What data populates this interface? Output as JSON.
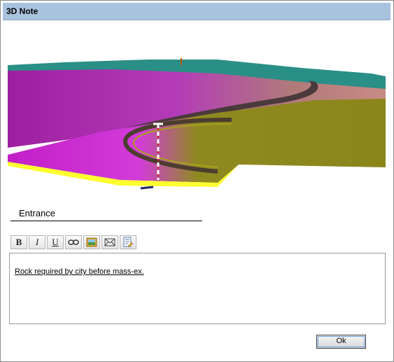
{
  "window": {
    "title": "3D Note"
  },
  "note": {
    "title": "Entrance",
    "body": "Rock required by city before mass-ex.",
    "toolbar": [
      {
        "name": "bold-button",
        "label": "B"
      },
      {
        "name": "italic-button",
        "label": "I"
      },
      {
        "name": "underline-button",
        "label": "U"
      },
      {
        "name": "link-button",
        "icon": "link-icon"
      },
      {
        "name": "insert-image-button",
        "icon": "image-icon"
      },
      {
        "name": "email-button",
        "icon": "envelope-icon"
      },
      {
        "name": "note-properties-button",
        "icon": "document-edit-icon"
      }
    ]
  },
  "buttons": {
    "ok": "Ok"
  },
  "colors": {
    "titlebar": "#a9c2de",
    "terrain_magenta": "#c81fc8",
    "terrain_olive": "#8e8e1a",
    "terrain_teal": "#2b9a8a"
  }
}
